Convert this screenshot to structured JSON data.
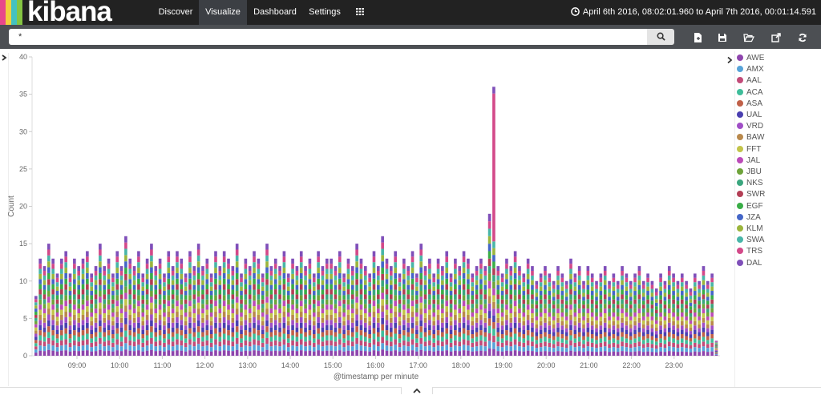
{
  "app": {
    "brand": "kibana",
    "brand_colors": [
      "#e8488b",
      "#f2d03c",
      "#44c2c0",
      "#85c442"
    ]
  },
  "nav": [
    {
      "label": "Discover",
      "active": false
    },
    {
      "label": "Visualize",
      "active": true
    },
    {
      "label": "Dashboard",
      "active": false
    },
    {
      "label": "Settings",
      "active": false
    }
  ],
  "apps_menu_icon": "grid-icon",
  "time_range": {
    "icon": "clock-icon",
    "text": "April 6th 2016, 08:02:01.960 to April 7th 2016, 00:01:14.591"
  },
  "query": {
    "value": "*",
    "search_icon": "search-icon"
  },
  "toolbar": [
    "new-visualization-icon",
    "save-icon",
    "open-folder-icon",
    "share-icon",
    "refresh-icon"
  ],
  "chart_data": {
    "type": "bar",
    "stacked": true,
    "ylabel": "Count",
    "xlabel": "@timestamp per minute",
    "ylim": [
      0,
      40
    ],
    "yticks": [
      0,
      5,
      10,
      15,
      20,
      25,
      30,
      35,
      40
    ],
    "xticks": [
      "09:00",
      "10:00",
      "11:00",
      "12:00",
      "13:00",
      "14:00",
      "15:00",
      "16:00",
      "17:00",
      "18:00",
      "19:00",
      "20:00",
      "21:00",
      "22:00",
      "23:00"
    ],
    "bar_count": 160,
    "totals": [
      8,
      13,
      12,
      15,
      13,
      11,
      13,
      14,
      11,
      13,
      12,
      13,
      14,
      11,
      12,
      15,
      12,
      13,
      11,
      14,
      12,
      16,
      13,
      12,
      14,
      11,
      13,
      15,
      12,
      13,
      11,
      14,
      12,
      14,
      13,
      11,
      14,
      12,
      15,
      12,
      13,
      11,
      14,
      12,
      14,
      13,
      12,
      15,
      11,
      13,
      12,
      14,
      13,
      11,
      15,
      12,
      13,
      12,
      14,
      11,
      13,
      12,
      14,
      12,
      13,
      11,
      14,
      12,
      13,
      13,
      12,
      14,
      11,
      13,
      12,
      15,
      13,
      12,
      11,
      14,
      12,
      16,
      13,
      12,
      14,
      11,
      13,
      12,
      14,
      11,
      15,
      12,
      13,
      11,
      13,
      12,
      14,
      11,
      13,
      12,
      14,
      13,
      11,
      12,
      13,
      12,
      19,
      36,
      12,
      11,
      13,
      12,
      14,
      12,
      11,
      13,
      12,
      10,
      11,
      12,
      11,
      10,
      12,
      11,
      10,
      13,
      11,
      12,
      10,
      12,
      11,
      10,
      11,
      12,
      10,
      11,
      10,
      12,
      11,
      10,
      11,
      12,
      10,
      11,
      10,
      9,
      11,
      10,
      12,
      11,
      10,
      11,
      10,
      9,
      11,
      10,
      12,
      10,
      11,
      2
    ],
    "series": [
      "AWE",
      "AMX",
      "AAL",
      "ACA",
      "ASA",
      "UAL",
      "VRD",
      "BAW",
      "FFT",
      "JAL",
      "JBU",
      "NKS",
      "SWR",
      "EGF",
      "JZA",
      "KLM",
      "SWA",
      "TRS",
      "DAL"
    ],
    "colors": [
      "#8e44ad",
      "#57a3d8",
      "#c24b79",
      "#3ebd9a",
      "#c06048",
      "#4a3fb0",
      "#a04ec6",
      "#b9894c",
      "#c2c44a",
      "#bb4bb8",
      "#6ea33a",
      "#3aa67e",
      "#b33e55",
      "#39ad46",
      "#4466c7",
      "#9bb53c",
      "#48b5a8",
      "#d34989",
      "#7f4fb9"
    ]
  }
}
